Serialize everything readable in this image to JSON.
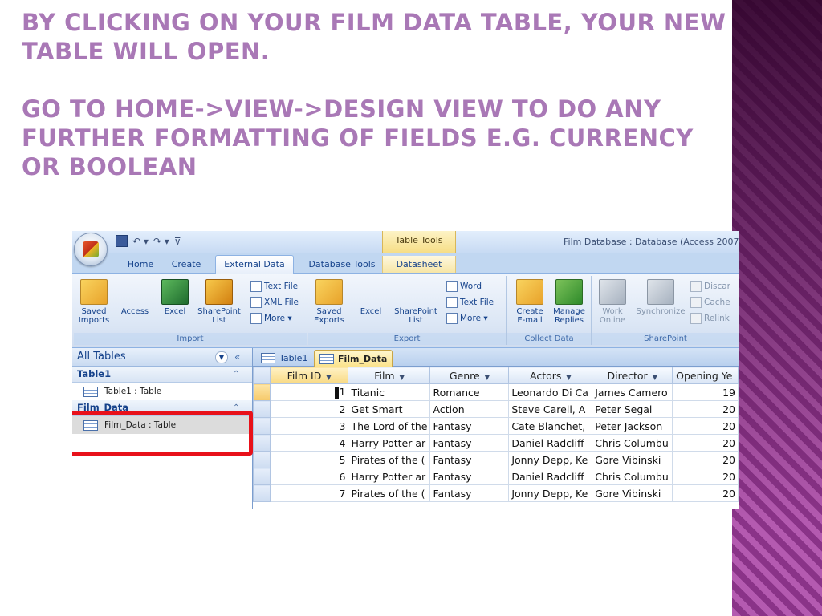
{
  "slide": {
    "title_lines": [
      "By clicking on your Film Data table, your new",
      "table will open.",
      "Go to Home->View->Design view to do any",
      "further formatting of fields e.g. currency",
      "or Boolean"
    ]
  },
  "access": {
    "context_tab": "Table Tools",
    "window_title": "Film Database : Database (Access 2007) -",
    "ribbon_tabs": [
      "Home",
      "Create",
      "External Data",
      "Database Tools",
      "Datasheet"
    ],
    "active_tab": "External Data",
    "ribbon": {
      "import": {
        "label": "Import",
        "saved_imports": "Saved Imports",
        "access": "Access",
        "excel": "Excel",
        "sharepoint_list": "SharePoint List",
        "text_file": "Text File",
        "xml_file": "XML File",
        "more": "More ▾"
      },
      "export": {
        "label": "Export",
        "saved_exports": "Saved Exports",
        "excel": "Excel",
        "sharepoint_list": "SharePoint List",
        "word": "Word",
        "text_file": "Text File",
        "more": "More ▾"
      },
      "collect": {
        "label": "Collect Data",
        "create_email": "Create E-mail",
        "manage_replies": "Manage Replies"
      },
      "sharepoint": {
        "label": "SharePoint",
        "work_online": "Work Online",
        "synchronize": "Synchronize",
        "discard": "Discar",
        "cache": "Cache",
        "relink": "Relink"
      }
    },
    "nav": {
      "header": "All Tables",
      "collapse": "«",
      "groups": [
        {
          "name": "Table1",
          "item": "Table1 : Table"
        },
        {
          "name": "Film_Data",
          "item": "Film_Data : Table"
        }
      ]
    },
    "doc_tabs": [
      "Table1",
      "Film_Data"
    ],
    "datasheet": {
      "columns": [
        "Film ID",
        "Film",
        "Genre",
        "Actors",
        "Director",
        "Opening Ye"
      ],
      "rows": [
        [
          "1",
          "Titanic",
          "Romance",
          "Leonardo Di Ca",
          "James Camero",
          "19"
        ],
        [
          "2",
          "Get Smart",
          "Action",
          "Steve Carell, A",
          "Peter Segal",
          "20"
        ],
        [
          "3",
          "The Lord of the",
          "Fantasy",
          "Cate Blanchet,",
          "Peter Jackson",
          "20"
        ],
        [
          "4",
          "Harry Potter ar",
          "Fantasy",
          "Daniel Radcliff",
          "Chris Columbu",
          "20"
        ],
        [
          "5",
          "Pirates of the (",
          "Fantasy",
          "Jonny Depp, Ke",
          "Gore Vibinski",
          "20"
        ],
        [
          "6",
          "Harry Potter ar",
          "Fantasy",
          "Daniel Radcliff",
          "Chris Columbu",
          "20"
        ],
        [
          "7",
          "Pirates of the (",
          "Fantasy",
          "Jonny Depp, Ke",
          "Gore Vibinski",
          "20"
        ]
      ]
    }
  }
}
